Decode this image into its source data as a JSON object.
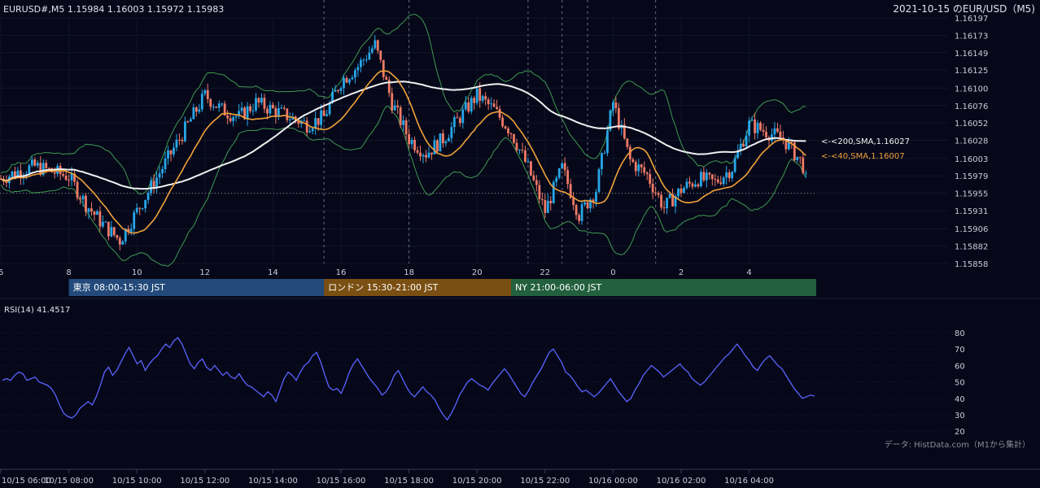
{
  "header": {
    "ohlc_label": "EURUSD#,M5 1.15984 1.16003 1.15972 1.15983",
    "title": "2021-10-15 のEUR/USD（M5)"
  },
  "ma_labels": {
    "sma200": "<-<200,SMA,1.16027",
    "sma40": "<-<40,SMA,1.16007"
  },
  "sessions": [
    {
      "label": "東京 08:00-15:30 JST",
      "start": 8,
      "end": 15.5,
      "color": "#234a7a"
    },
    {
      "label": "ロンドン 15:30-21:00 JST",
      "start": 15.5,
      "end": 21,
      "color": "#7a4f12"
    },
    {
      "label": "NY 21:00-06:00 JST",
      "start": 21,
      "end": 30,
      "color": "#23603e"
    }
  ],
  "rsi": {
    "label": "RSI(14) 41.4517",
    "ticks": [
      "80",
      "70",
      "60",
      "50",
      "40",
      "30",
      "20"
    ],
    "levels": [
      80,
      70,
      60,
      50,
      40,
      30,
      20
    ],
    "values": [
      51,
      52,
      51,
      54,
      56,
      55,
      51,
      52,
      53,
      50,
      49,
      48,
      46,
      42,
      36,
      31,
      29,
      28,
      30,
      34,
      36,
      38,
      36,
      41,
      48,
      56,
      59,
      54,
      57,
      62,
      67,
      71,
      66,
      61,
      63,
      57,
      61,
      64,
      66,
      70,
      73,
      71,
      75,
      77,
      73,
      67,
      61,
      58,
      62,
      64,
      59,
      57,
      60,
      57,
      54,
      56,
      53,
      52,
      55,
      51,
      48,
      47,
      45,
      43,
      41,
      44,
      42,
      38,
      45,
      52,
      56,
      54,
      51,
      56,
      60,
      62,
      66,
      68,
      62,
      54,
      47,
      45,
      46,
      43,
      49,
      56,
      61,
      64,
      60,
      56,
      52,
      49,
      46,
      42,
      44,
      48,
      54,
      57,
      52,
      47,
      43,
      41,
      44,
      47,
      44,
      42,
      39,
      34,
      30,
      27,
      31,
      36,
      42,
      46,
      50,
      52,
      50,
      48,
      47,
      45,
      49,
      52,
      55,
      58,
      55,
      51,
      47,
      43,
      41,
      45,
      50,
      54,
      58,
      63,
      68,
      70,
      66,
      62,
      56,
      54,
      51,
      47,
      44,
      45,
      43,
      41,
      43,
      46,
      49,
      52,
      48,
      44,
      41,
      38,
      40,
      45,
      49,
      54,
      57,
      60,
      58,
      56,
      53,
      55,
      57,
      59,
      61,
      58,
      56,
      52,
      50,
      48,
      50,
      53,
      56,
      59,
      62,
      65,
      67,
      70,
      73,
      70,
      66,
      63,
      59,
      57,
      61,
      64,
      66,
      63,
      60,
      58,
      54,
      50,
      46,
      43,
      40,
      41,
      42,
      41.45
    ]
  },
  "chart_data": {
    "type": "candlestick",
    "symbol": "EURUSD#",
    "timeframe": "M5",
    "y_ticks": [
      "1.16197",
      "1.16173",
      "1.16149",
      "1.16125",
      "1.16100",
      "1.16076",
      "1.16052",
      "1.16028",
      "1.16003",
      "1.15979",
      "1.15955",
      "1.15931",
      "1.15906",
      "1.15882",
      "1.15858"
    ],
    "ylim": [
      1.15858,
      1.16197
    ],
    "hour_ticks": [
      "6",
      "8",
      "10",
      "12",
      "14",
      "16",
      "18",
      "20",
      "22",
      "0",
      "2",
      "4"
    ],
    "date_ticks": [
      "10/15 06:00",
      "10/15 08:00",
      "10/15 10:00",
      "10/15 12:00",
      "10/15 14:00",
      "10/15 16:00",
      "10/15 18:00",
      "10/15 20:00",
      "10/15 22:00",
      "10/16 00:00",
      "10/16 02:00",
      "10/16 04:00"
    ],
    "last_price": 1.15983,
    "ref_price": 1.15955,
    "session_lines": [
      15.5,
      18,
      21.5,
      22.5,
      23.25,
      25.25
    ],
    "sma200": {
      "name": "200 SMA",
      "value": 1.16027,
      "color": "#f0f0f0"
    },
    "sma40": {
      "name": "40 SMA",
      "value": 1.16007,
      "color": "#f2a23a"
    },
    "close_path": [
      [
        6.0,
        1.15975
      ],
      [
        6.5,
        1.15985
      ],
      [
        7.0,
        1.15992
      ],
      [
        7.5,
        1.15985
      ],
      [
        8.0,
        1.15978
      ],
      [
        8.5,
        1.1594
      ],
      [
        9.0,
        1.15912
      ],
      [
        9.5,
        1.1589
      ],
      [
        10.0,
        1.1593
      ],
      [
        10.5,
        1.1597
      ],
      [
        11.0,
        1.1601
      ],
      [
        11.5,
        1.1605
      ],
      [
        12.0,
        1.1609
      ],
      [
        12.5,
        1.1607
      ],
      [
        13.0,
        1.1606
      ],
      [
        13.5,
        1.1608
      ],
      [
        14.0,
        1.1607
      ],
      [
        14.5,
        1.1606
      ],
      [
        15.0,
        1.1605
      ],
      [
        15.5,
        1.1606
      ],
      [
        16.0,
        1.1611
      ],
      [
        16.5,
        1.1613
      ],
      [
        17.0,
        1.1616
      ],
      [
        17.5,
        1.1608
      ],
      [
        18.0,
        1.1603
      ],
      [
        18.5,
        1.1601
      ],
      [
        19.0,
        1.1603
      ],
      [
        19.5,
        1.1606
      ],
      [
        20.0,
        1.1609
      ],
      [
        20.5,
        1.1607
      ],
      [
        21.0,
        1.1604
      ],
      [
        21.5,
        1.1599
      ],
      [
        22.0,
        1.1593
      ],
      [
        22.5,
        1.1599
      ],
      [
        23.0,
        1.15925
      ],
      [
        23.5,
        1.1596
      ],
      [
        24.0,
        1.1608
      ],
      [
        24.5,
        1.16
      ],
      [
        25.0,
        1.1598
      ],
      [
        25.5,
        1.15935
      ],
      [
        26.0,
        1.1596
      ],
      [
        26.5,
        1.15975
      ],
      [
        27.0,
        1.1597
      ],
      [
        27.5,
        1.1599
      ],
      [
        28.0,
        1.1605
      ],
      [
        28.5,
        1.1604
      ],
      [
        29.0,
        1.1603
      ],
      [
        29.5,
        1.16
      ],
      [
        29.7,
        1.15983
      ]
    ]
  },
  "credit": "データ: HistData.com（M1から集計）"
}
